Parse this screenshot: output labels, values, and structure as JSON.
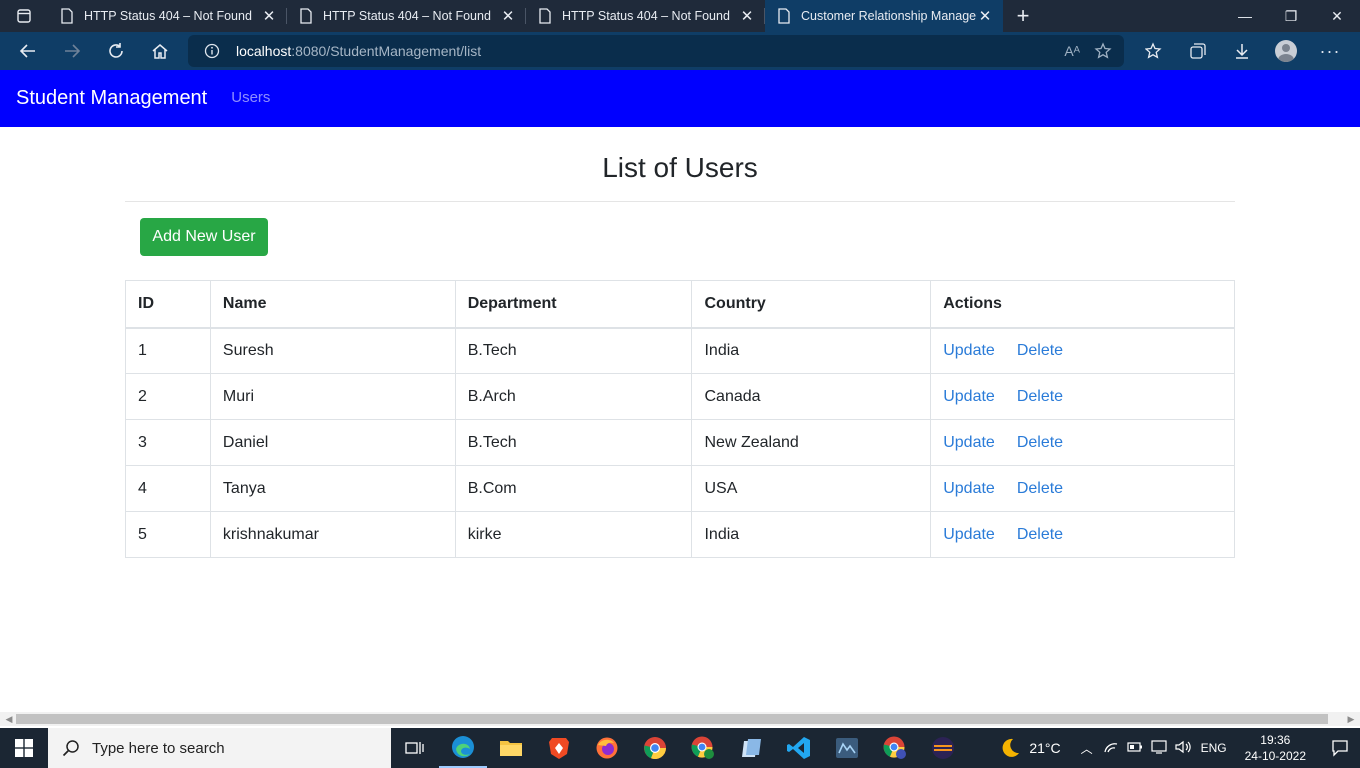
{
  "browser": {
    "tabs": [
      {
        "title": "HTTP Status 404 – Not Found"
      },
      {
        "title": "HTTP Status 404 – Not Found"
      },
      {
        "title": "HTTP Status 404 – Not Found"
      },
      {
        "title": "Customer Relationship Managem"
      }
    ],
    "url_host": "localhost",
    "url_rest": ":8080/StudentManagement/list",
    "read_aloud_label": "Aᴬ"
  },
  "app": {
    "brand": "Student Management",
    "nav_users": "Users",
    "page_title": "List of Users",
    "add_button": "Add New User",
    "table": {
      "headers": [
        "ID",
        "Name",
        "Department",
        "Country",
        "Actions"
      ],
      "rows": [
        {
          "id": "1",
          "name": "Suresh",
          "department": "B.Tech",
          "country": "India",
          "update": "Update",
          "delete": "Delete"
        },
        {
          "id": "2",
          "name": "Muri",
          "department": "B.Arch",
          "country": "Canada",
          "update": "Update",
          "delete": "Delete"
        },
        {
          "id": "3",
          "name": "Daniel",
          "department": "B.Tech",
          "country": "New Zealand",
          "update": "Update",
          "delete": "Delete"
        },
        {
          "id": "4",
          "name": "Tanya",
          "department": "B.Com",
          "country": "USA",
          "update": "Update",
          "delete": "Delete"
        },
        {
          "id": "5",
          "name": "krishnakumar",
          "department": "kirke",
          "country": "India",
          "update": "Update",
          "delete": "Delete"
        }
      ]
    }
  },
  "taskbar": {
    "search_placeholder": "Type here to search",
    "temperature": "21°C",
    "language": "ENG",
    "time": "19:36",
    "date": "24-10-2022"
  },
  "colors": {
    "header_bg": "#0000ff",
    "add_button_bg": "#28a745",
    "link": "#2a7bd8",
    "tab_active_bg": "#0f3d66"
  }
}
